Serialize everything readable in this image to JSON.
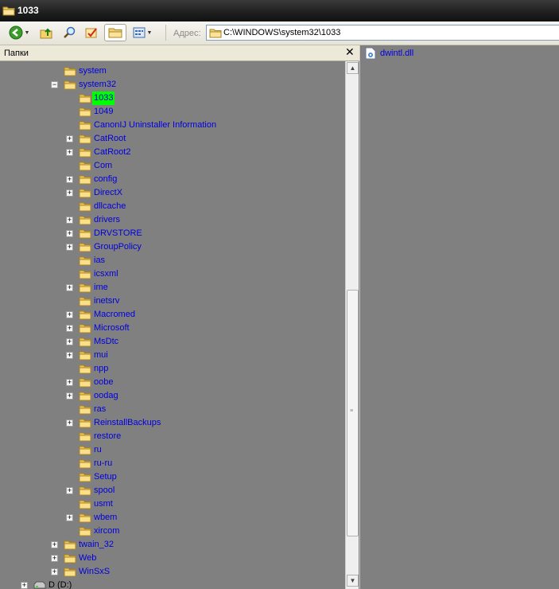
{
  "window": {
    "title": "1033"
  },
  "toolbar": {
    "address_label": "Адрес:",
    "address_value": "C:\\WINDOWS\\system32\\1033",
    "buttons": [
      "back-icon",
      "up-folder-icon",
      "search-icon",
      "check-icon",
      "folders-icon",
      "views-icon"
    ]
  },
  "folders_pane": {
    "title": "Папки",
    "close": "✕"
  },
  "tree": [
    {
      "label": "system",
      "depth": 0,
      "expand": ""
    },
    {
      "label": "system32",
      "depth": 0,
      "expand": "minus"
    },
    {
      "label": "1033",
      "depth": 1,
      "expand": "",
      "selected": true
    },
    {
      "label": "1049",
      "depth": 1,
      "expand": ""
    },
    {
      "label": "CanonIJ Uninstaller Information",
      "depth": 1,
      "expand": ""
    },
    {
      "label": "CatRoot",
      "depth": 1,
      "expand": "plus"
    },
    {
      "label": "CatRoot2",
      "depth": 1,
      "expand": "plus"
    },
    {
      "label": "Com",
      "depth": 1,
      "expand": ""
    },
    {
      "label": "config",
      "depth": 1,
      "expand": "plus"
    },
    {
      "label": "DirectX",
      "depth": 1,
      "expand": "plus"
    },
    {
      "label": "dllcache",
      "depth": 1,
      "expand": ""
    },
    {
      "label": "drivers",
      "depth": 1,
      "expand": "plus"
    },
    {
      "label": "DRVSTORE",
      "depth": 1,
      "expand": "plus"
    },
    {
      "label": "GroupPolicy",
      "depth": 1,
      "expand": "plus"
    },
    {
      "label": "ias",
      "depth": 1,
      "expand": ""
    },
    {
      "label": "icsxml",
      "depth": 1,
      "expand": ""
    },
    {
      "label": "ime",
      "depth": 1,
      "expand": "plus"
    },
    {
      "label": "inetsrv",
      "depth": 1,
      "expand": ""
    },
    {
      "label": "Macromed",
      "depth": 1,
      "expand": "plus"
    },
    {
      "label": "Microsoft",
      "depth": 1,
      "expand": "plus"
    },
    {
      "label": "MsDtc",
      "depth": 1,
      "expand": "plus"
    },
    {
      "label": "mui",
      "depth": 1,
      "expand": "plus"
    },
    {
      "label": "npp",
      "depth": 1,
      "expand": ""
    },
    {
      "label": "oobe",
      "depth": 1,
      "expand": "plus"
    },
    {
      "label": "oodag",
      "depth": 1,
      "expand": "plus"
    },
    {
      "label": "ras",
      "depth": 1,
      "expand": ""
    },
    {
      "label": "ReinstallBackups",
      "depth": 1,
      "expand": "plus"
    },
    {
      "label": "restore",
      "depth": 1,
      "expand": ""
    },
    {
      "label": "ru",
      "depth": 1,
      "expand": ""
    },
    {
      "label": "ru-ru",
      "depth": 1,
      "expand": ""
    },
    {
      "label": "Setup",
      "depth": 1,
      "expand": ""
    },
    {
      "label": "spool",
      "depth": 1,
      "expand": "plus"
    },
    {
      "label": "usmt",
      "depth": 1,
      "expand": ""
    },
    {
      "label": "wbem",
      "depth": 1,
      "expand": "plus"
    },
    {
      "label": "xircom",
      "depth": 1,
      "expand": ""
    },
    {
      "label": "twain_32",
      "depth": 0,
      "expand": "plus"
    },
    {
      "label": "Web",
      "depth": 0,
      "expand": "plus"
    },
    {
      "label": "WinSxS",
      "depth": 0,
      "expand": "plus"
    },
    {
      "label": "D (D:)",
      "depth": -2,
      "expand": "plus",
      "drive": true
    }
  ],
  "files": [
    {
      "name": "dwintl.dll",
      "icon": "dll-file-icon"
    }
  ],
  "colors": {
    "selection": "#00ff00",
    "link": "#0000dd",
    "pane_bg": "#808080"
  }
}
